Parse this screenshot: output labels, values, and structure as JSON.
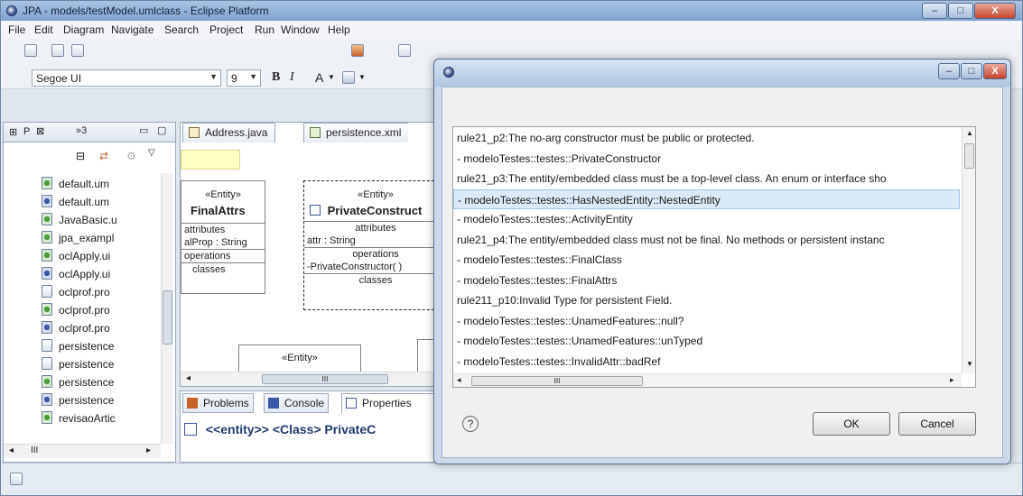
{
  "window": {
    "title": "JPA - models/testModel.umlclass - Eclipse Platform",
    "controls": [
      "–",
      "□",
      "X"
    ]
  },
  "menu": [
    "File",
    "Edit",
    "Diagram",
    "Navigate",
    "Search",
    "Project",
    "Run",
    "Window",
    "Help"
  ],
  "toolbar": {
    "font_name": "Segoe UI",
    "font_size": "9",
    "bold": "B",
    "italic": "I",
    "text_color": "A"
  },
  "explorer": {
    "tab_label": "P",
    "overflow_count": "»3",
    "files": [
      {
        "name": "default.um",
        "icon": "green"
      },
      {
        "name": "default.um",
        "icon": "blue"
      },
      {
        "name": "JavaBasic.u",
        "icon": "green"
      },
      {
        "name": "jpa_exampl",
        "icon": "green"
      },
      {
        "name": "oclApply.ui",
        "icon": "green"
      },
      {
        "name": "oclApply.ui",
        "icon": "blue"
      },
      {
        "name": "oclprof.pro",
        "icon": "plain"
      },
      {
        "name": "oclprof.pro",
        "icon": "green"
      },
      {
        "name": "oclprof.pro",
        "icon": "blue"
      },
      {
        "name": "persistence",
        "icon": "plain"
      },
      {
        "name": "persistence",
        "icon": "plain"
      },
      {
        "name": "persistence",
        "icon": "green"
      },
      {
        "name": "persistence",
        "icon": "blue"
      },
      {
        "name": "revisaoArtic",
        "icon": "green"
      }
    ]
  },
  "editor": {
    "tabs": [
      "Address.java",
      "persistence.xml"
    ],
    "class1": {
      "stereotype": "«Entity»",
      "name": "FinalAttrs",
      "attr_header": "attributes",
      "attr": "alProp : String",
      "ops_header": "operations",
      "classes_header": "classes"
    },
    "class2": {
      "stereotype": "«Entity»",
      "name": "PrivateConstruct",
      "attr_header": "attributes",
      "attr": "attr : String",
      "ops_header": "operations",
      "op": "-PrivateConstructor( )",
      "classes_header": "classes"
    },
    "class3": {
      "stereotype": "«Entity»"
    },
    "hscroll_thumb": "III"
  },
  "bottom": {
    "tabs": [
      "Problems",
      "Console",
      "Properties"
    ],
    "selection_label": "<<entity>> <Class> PrivateC"
  },
  "dialog": {
    "lines": [
      "rule21_p2:The no-arg constructor must be public or protected.",
      " - modeloTestes::testes::PrivateConstructor",
      "rule21_p3:The entity/embedded class must be a top-level class. An enum or interface sho",
      " - modeloTestes::testes::HasNestedEntity::NestedEntity",
      " - modeloTestes::testes::ActivityEntity",
      "rule21_p4:The entity/embedded class must not be final. No methods or persistent instanc",
      " - modeloTestes::testes::FinalClass",
      " - modeloTestes::testes::FinalAttrs",
      "rule211_p10:Invalid Type for persistent Field.",
      " - modeloTestes::testes::UnamedFeatures::null?",
      " - modeloTestes::testes::UnamedFeatures::unTyped",
      " - modeloTestes::testes::InvalidAttr::badRef"
    ],
    "selected_index": 3,
    "hscroll_thumb": "III",
    "help": "?",
    "ok": "OK",
    "cancel": "Cancel"
  }
}
